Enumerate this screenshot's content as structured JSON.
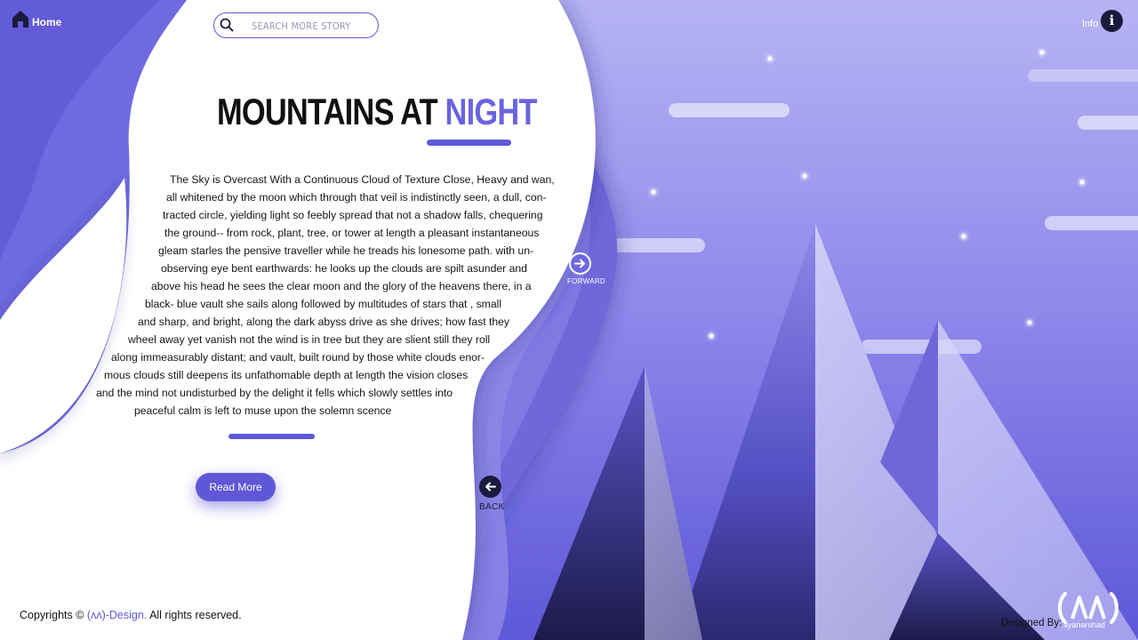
{
  "nav": {
    "home_label": "Home",
    "info_label": "Info",
    "home_icon": "home-icon",
    "info_icon": "info-icon"
  },
  "search": {
    "placeholder": "SEARCH MORE STORY",
    "value": "",
    "icon": "search-icon"
  },
  "article": {
    "title_main": "MOUNTAINS AT ",
    "title_accent": "NIGHT",
    "lines": [
      "The Sky is Overcast With a Continuous Cloud of Texture Close, Heavy and wan,",
      "all whitened by the moon which through that veil is indistinctly seen, a dull, con-",
      "tracted circle, yielding light so feebly spread that not a shadow falls, chequering",
      "the ground-- from rock, plant, tree, or tower at length a pleasant instantaneous",
      "gleam starles the pensive traveller while he treads his lonesome path. with un-",
      "observing eye bent earthwards: he looks up the clouds are spilt asunder and",
      "above his head he sees the clear moon and the glory of the heavens there, in a",
      "black- blue vault she sails along followed by multitudes of stars that , small",
      "and sharp, and bright, along the dark abyss drive as she drives; how fast they",
      "wheel away yet vanish not the wind is in tree but they are slient still they roll",
      "along immeasurably distant; and vault, built round by those white clouds enor-",
      "mous clouds still deepens its unfathomable depth at length the vision closes",
      "and the mind not undisturbed by the delight it fells which slowly settles into",
      "peaceful calm  is left to muse upon the solemn scence"
    ],
    "read_more_label": "Read More"
  },
  "pager": {
    "forward_label": "FORWARD",
    "back_label": "BACK",
    "forward_icon": "arrow-right-icon",
    "back_icon": "arrow-left-icon"
  },
  "footer": {
    "copyright_prefix": "Copyrights © ",
    "copyright_brand": "(ʌʌ)-Design.",
    "copyright_suffix": " All rights reserved.",
    "designed_by_label": "Designed By:",
    "logo_text": "(ʌʌ)",
    "logo_subtext": "ayanarshad"
  },
  "colors": {
    "accent": "#5e58d6",
    "dark": "#1b1a3d",
    "sky_top": "#b3b0f3",
    "sky_bottom": "#6f69e0"
  }
}
